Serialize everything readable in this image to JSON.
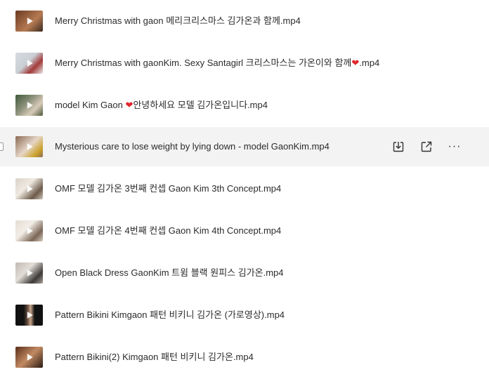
{
  "files": [
    {
      "name": "Merry Christmas with gaon 메리크리스마스 김가온과 함께.mp4",
      "thumb": [
        "#6b3a22",
        "#b57a52"
      ]
    },
    {
      "name_pre": "Merry Christmas with gaonKim. Sexy Santagirl 크리스마스는 가온이와 함께",
      "heart": "❤",
      "name_post": ".mp4",
      "thumb": [
        "#c9cfd4",
        "#a33a3a"
      ]
    },
    {
      "name_pre": "model Kim Gaon ",
      "heart": "❤",
      "name_post": "안녕하세요 모델 김가온입니다.mp4",
      "thumb": [
        "#3f5a3a",
        "#d8cbb8"
      ]
    },
    {
      "name": "Mysterious care to lose weight by lying down - model GaonKim.mp4",
      "thumb": [
        "#8a6a55",
        "#e6d6c8"
      ]
    },
    {
      "name": "OMF 모델 김가온 3번째 컨셉 Gaon Kim 3th Concept.mp4",
      "thumb": [
        "#d9d2c8",
        "#6d5a4a"
      ]
    },
    {
      "name": "OMF 모델 김가온 4번째 컨셉 Gaon Kim 4th Concept.mp4",
      "thumb": [
        "#e3ddd4",
        "#7b6655"
      ]
    },
    {
      "name": "Open Black Dress GaonKim 트윔 블랙 원피스 김가온.mp4",
      "thumb": [
        "#bfb9b2",
        "#3c3a38"
      ]
    },
    {
      "name": "Pattern Bikini Kimgaon 패턴 비키니 김가온 (가로영상).mp4",
      "thumb": [
        "#111111",
        "#6a5040"
      ]
    },
    {
      "name": "Pattern Bikini(2) Kimgaon 패턴 비키니 김가온.mp4",
      "thumb": [
        "#5a2e1c",
        "#c28a62"
      ]
    }
  ],
  "hover_actions": {
    "download_icon": "download-icon",
    "share_icon": "open-external-icon",
    "more_label": "···"
  }
}
